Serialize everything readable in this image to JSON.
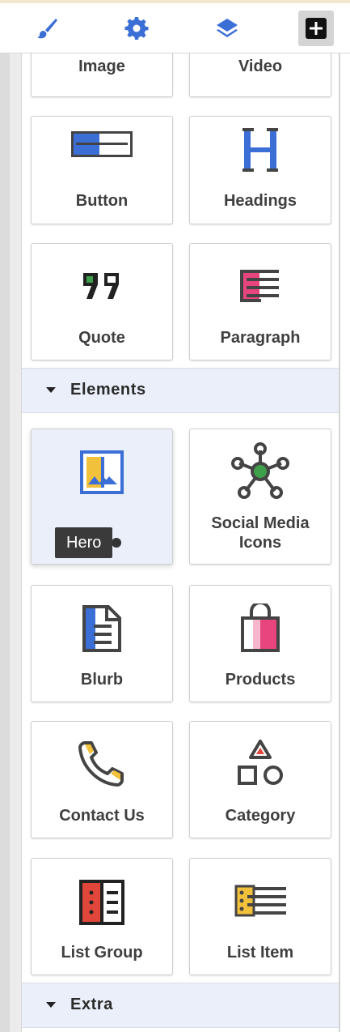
{
  "toolbar": {
    "items": [
      {
        "name": "brush-icon",
        "label": "Style"
      },
      {
        "name": "gear-icon",
        "label": "Settings"
      },
      {
        "name": "layers-icon",
        "label": "Layers"
      },
      {
        "name": "add-block-icon",
        "label": "Add"
      }
    ]
  },
  "basic": {
    "image_label": "Image",
    "video_label": "Video",
    "button_label": "Button",
    "headings_label": "Headings",
    "quote_label": "Quote",
    "paragraph_label": "Paragraph"
  },
  "elements": {
    "section_title": "Elements",
    "hero_tooltip": "Hero",
    "social_label": "Social Media Icons",
    "blurb_label": "Blurb",
    "products_label": "Products",
    "contact_label": "Contact Us",
    "category_label": "Category",
    "list_group_label": "List Group",
    "list_item_label": "List Item"
  },
  "extra": {
    "section_title": "Extra"
  },
  "colors": {
    "accent_blue": "#3b6fd6",
    "yellow": "#f2c13c",
    "red": "#e0473a",
    "pink": "#e8457e",
    "green": "#3ea04a",
    "dark": "#3f3f3f"
  }
}
